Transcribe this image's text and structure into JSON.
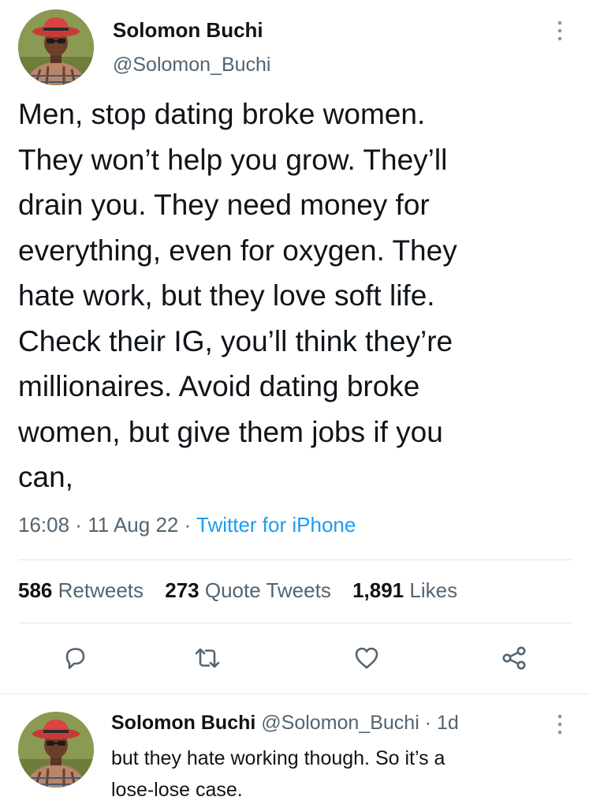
{
  "tweet": {
    "author_name": "Solomon Buchi",
    "author_handle": "@Solomon_Buchi",
    "text": "Men, stop dating broke women.\nThey won’t help you grow. They’ll\ndrain you. They need money for\neverything, even for oxygen. They\nhate work, but they love soft life.\nCheck their IG, you’ll think they’re\nmillionaires. Avoid dating broke\nwomen, but give them jobs if you\ncan,",
    "time": "16:08",
    "separator": " · ",
    "date": "11 Aug 22",
    "source": "Twitter for iPhone",
    "stats": {
      "retweets_count": "586",
      "retweets_label": "Retweets",
      "quotes_count": "273",
      "quotes_label": "Quote Tweets",
      "likes_count": "1,891",
      "likes_label": "Likes"
    },
    "actions": [
      "reply-icon",
      "retweet-icon",
      "like-icon",
      "share-icon"
    ]
  },
  "reply": {
    "author_name": "Solomon Buchi",
    "author_handle": "@Solomon_Buchi",
    "separator": " · ",
    "age": "1d",
    "text": "but they hate working though. So it’s a\nlose-lose case."
  },
  "colors": {
    "text_primary": "#0f1419",
    "text_secondary": "#536471",
    "link": "#1d9bf0",
    "divider": "#dfe4e8"
  }
}
